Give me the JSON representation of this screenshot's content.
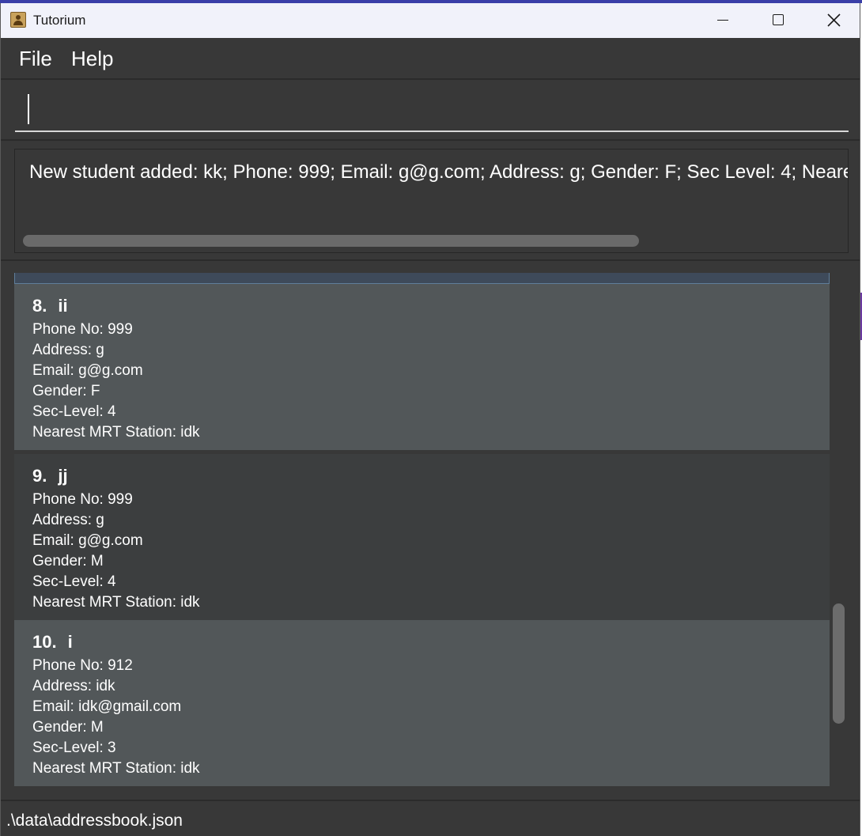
{
  "window": {
    "title": "Tutorium",
    "icon": "address-book-icon"
  },
  "menu": {
    "file": "File",
    "help": "Help"
  },
  "command": {
    "value": "",
    "placeholder": ""
  },
  "result": {
    "message": "New student added: kk; Phone: 999; Email: g@g.com; Address: g; Gender: F; Sec Level: 4; Neare"
  },
  "students": [
    {
      "index": "8.",
      "name": "ii",
      "phone": "Phone No: 999",
      "address": "Address: g",
      "email": "Email: g@g.com",
      "gender": "Gender: F",
      "sec_level": "Sec-Level: 4",
      "mrt": "Nearest MRT Station: idk"
    },
    {
      "index": "9.",
      "name": "jj",
      "phone": "Phone No: 999",
      "address": "Address: g",
      "email": "Email: g@g.com",
      "gender": "Gender: M",
      "sec_level": "Sec-Level: 4",
      "mrt": "Nearest MRT Station: idk"
    },
    {
      "index": "10.",
      "name": "i",
      "phone": "Phone No: 912",
      "address": "Address: idk",
      "email": "Email: idk@gmail.com",
      "gender": "Gender: M",
      "sec_level": "Sec-Level: 3",
      "mrt": "Nearest MRT Station: idk"
    }
  ],
  "status": {
    "file_path": ".\\data\\addressbook.json"
  },
  "colors": {
    "window_bg": "#383838",
    "card_light": "#525759",
    "card_dark": "#3c3e3f",
    "titlebar": "#f1f2fa"
  }
}
